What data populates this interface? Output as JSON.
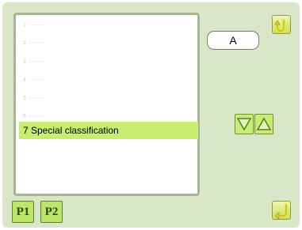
{
  "list": {
    "items": [
      {
        "label": "1 ------"
      },
      {
        "label": "2 ------"
      },
      {
        "label": "3 ------"
      },
      {
        "label": "4 ------"
      },
      {
        "label": "5 ------"
      },
      {
        "label": "6 ------"
      },
      {
        "label": "7 Special classification"
      }
    ],
    "selected_index": 6
  },
  "value_box": {
    "text": "A"
  },
  "pages": {
    "p1": "P1",
    "p2": "P2"
  },
  "icons": {
    "top_right": "return-arrow-icon",
    "bottom_right": "confirm-arrow-icon",
    "down": "triangle-down-icon",
    "up": "triangle-up-icon"
  },
  "colors": {
    "background": "#d9e6c7",
    "selected_row": "#c9ec72",
    "button_yellow": "#dde98a"
  }
}
